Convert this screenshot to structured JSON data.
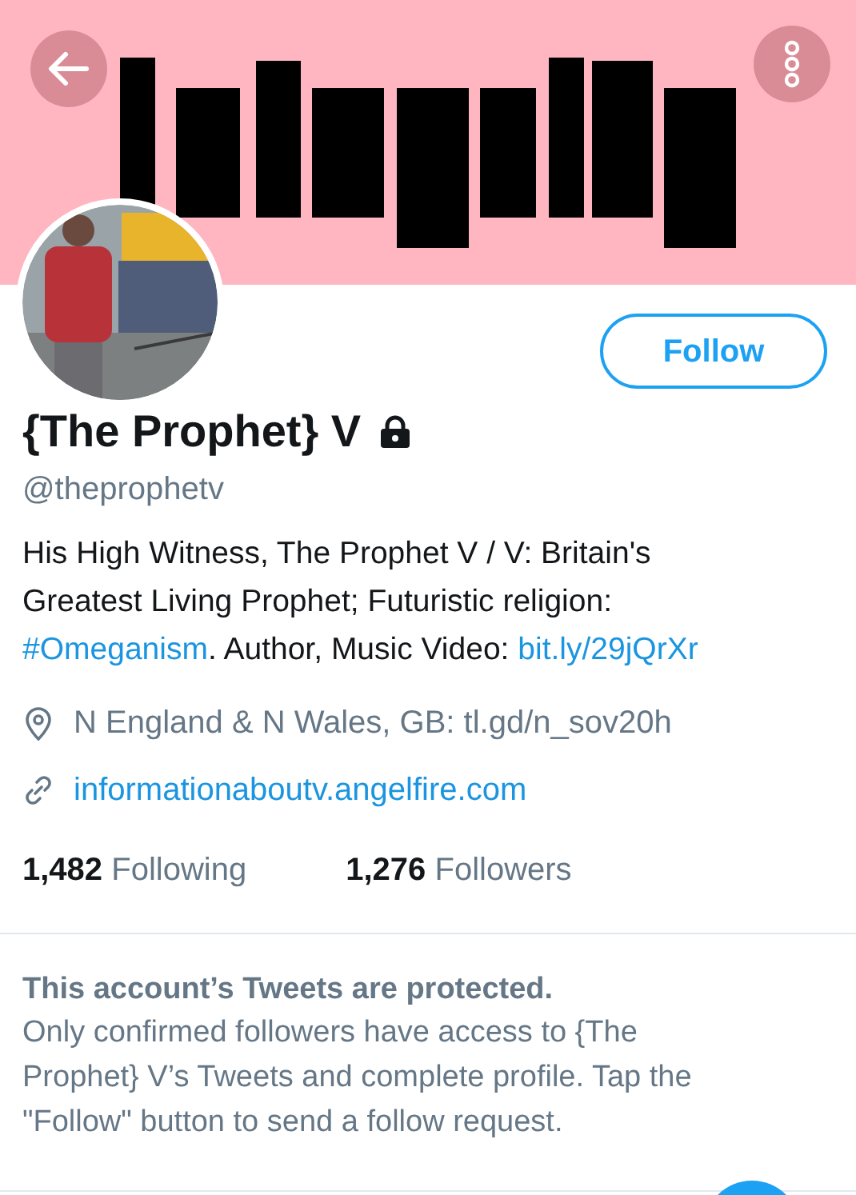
{
  "profile": {
    "name": "{The Prophet} V",
    "protected": true,
    "handle": "@theprophetv",
    "bio": [
      {
        "text": "His High Witness, The Prophet V / V: Britain's Greatest Living Prophet; Futuristic religion: ",
        "link": false
      },
      {
        "text": "#Omeganism",
        "link": true
      },
      {
        "text": ". Author, Music Video: ",
        "link": false
      },
      {
        "text": "bit.ly/29jQrXr",
        "link": true
      }
    ],
    "location": "N England & N Wales, GB: tl.gd/n_sov20h",
    "website": "informationaboutv.angelfire.com",
    "following_count": "1,482",
    "following_label": "Following",
    "followers_count": "1,276",
    "followers_label": "Followers"
  },
  "follow_button": "Follow",
  "notice": {
    "title": "This account’s Tweets are protected.",
    "body": "Only confirmed followers have access to {The Prophet} V’s Tweets and complete profile. Tap the \"Follow\" button to send a follow request."
  }
}
